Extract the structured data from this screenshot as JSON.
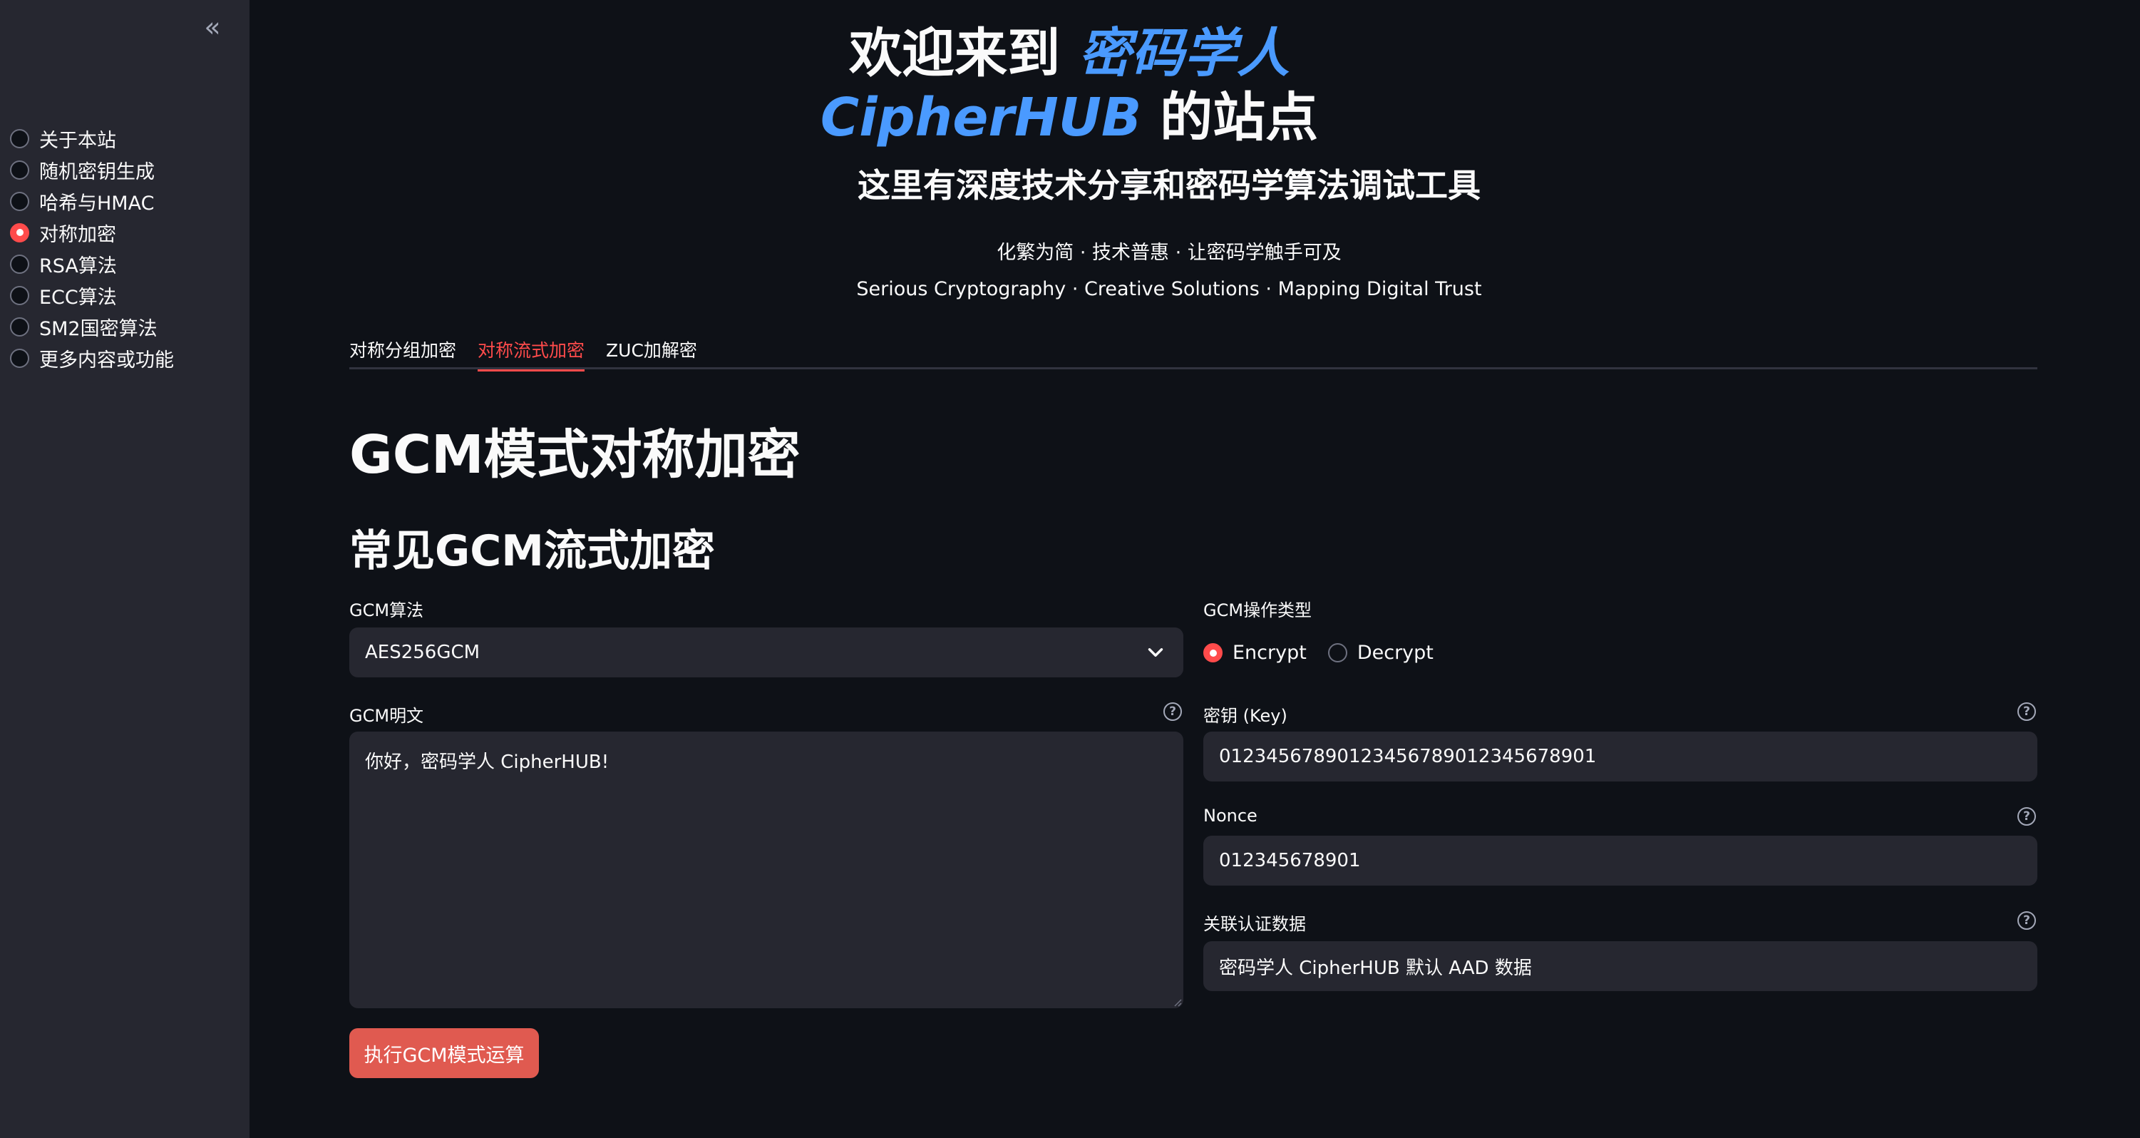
{
  "sidebar": {
    "collapse_icon": "double-chevron-left-icon",
    "collapse_glyph": "«",
    "items": [
      {
        "label": "关于本站",
        "selected": false
      },
      {
        "label": "随机密钥生成",
        "selected": false
      },
      {
        "label": "哈希与HMAC",
        "selected": false
      },
      {
        "label": "对称加密",
        "selected": true
      },
      {
        "label": "RSA算法",
        "selected": false
      },
      {
        "label": "ECC算法",
        "selected": false
      },
      {
        "label": "SM2国密算法",
        "selected": false
      },
      {
        "label": "更多内容或功能",
        "selected": false
      }
    ]
  },
  "header": {
    "title_prefix": "欢迎来到 ",
    "title_brand": "密码学人CipherHUB",
    "title_suffix": " 的站点",
    "subtitle": "这里有深度技术分享和密码学算法调试工具",
    "slogan_cn": "化繁为简 · 技术普惠 · 让密码学触手可及",
    "slogan_en": "Serious Cryptography · Creative Solutions · Mapping Digital Trust"
  },
  "tabs": [
    {
      "label": "对称分组加密",
      "active": false
    },
    {
      "label": "对称流式加密",
      "active": true
    },
    {
      "label": "ZUC加解密",
      "active": false
    }
  ],
  "main": {
    "page_heading": "GCM模式对称加密",
    "section_heading": "常见GCM流式加密",
    "algorithm": {
      "label": "GCM算法",
      "selected": "AES256GCM"
    },
    "operation": {
      "label": "GCM操作类型",
      "options": [
        {
          "label": "Encrypt",
          "selected": true
        },
        {
          "label": "Decrypt",
          "selected": false
        }
      ]
    },
    "plaintext": {
      "label": "GCM明文",
      "value": "你好，密码学人 CipherHUB!"
    },
    "key": {
      "label": "密钥 (Key)",
      "value": "01234567890123456789012345678901"
    },
    "nonce": {
      "label": "Nonce",
      "value": "012345678901"
    },
    "aad": {
      "label": "关联认证数据",
      "value": "密码学人 CipherHUB 默认 AAD 数据"
    },
    "run_button": "执行GCM模式运算",
    "help_glyph": "?"
  },
  "colors": {
    "accent": "#ff4b4b",
    "brand": "#4a9aff",
    "background": "#0e1117",
    "sidebar": "#262730",
    "button": "#e05a50"
  }
}
